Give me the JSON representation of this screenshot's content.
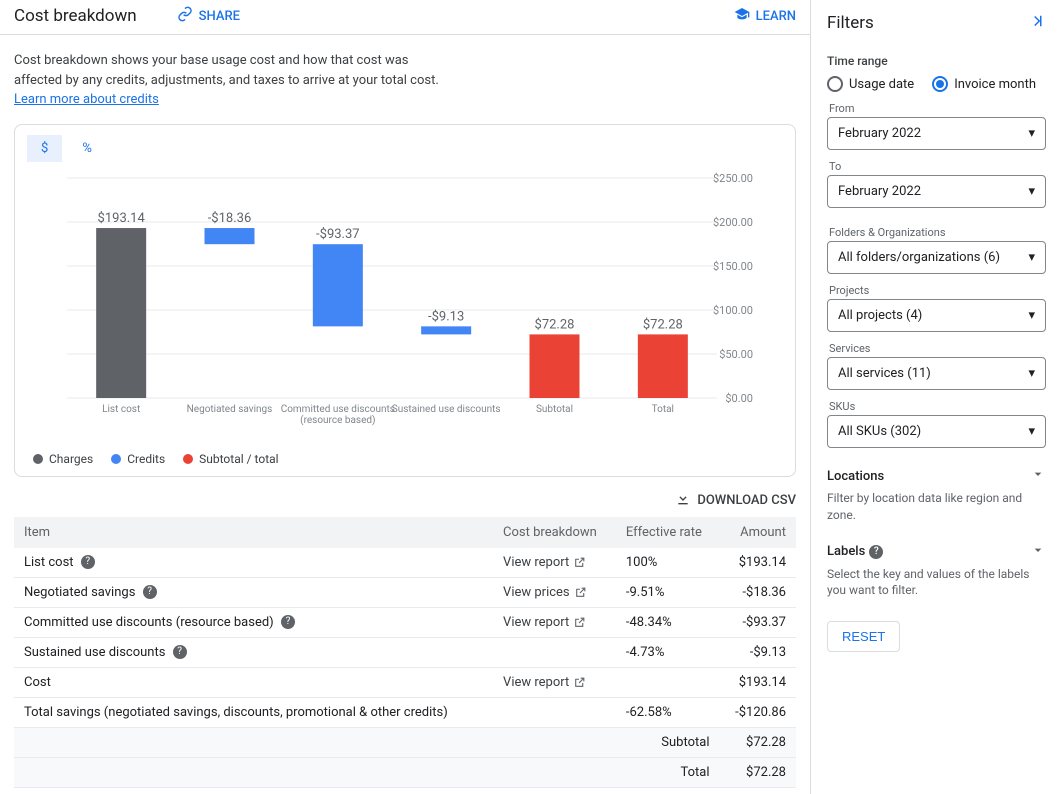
{
  "header": {
    "title": "Cost breakdown",
    "share": "SHARE",
    "learn": "LEARN"
  },
  "desc": {
    "text": "Cost breakdown shows your base usage cost and how that cost was affected by any credits, adjustments, and taxes to arrive at your total cost. ",
    "link": "Learn more about credits"
  },
  "tabs": {
    "currency": "$",
    "percent": "%"
  },
  "chart_data": {
    "type": "bar",
    "ylim": [
      0,
      250
    ],
    "ticks": [
      "$0.00",
      "$50.00",
      "$100.00",
      "$150.00",
      "$200.00",
      "$250.00"
    ],
    "categories": [
      "List cost",
      "Negotiated savings",
      "Committed use discounts (resource based)",
      "Sustained use discounts",
      "Subtotal",
      "Total"
    ],
    "bars": [
      {
        "label": "$193.14",
        "color": "#5f6368",
        "y0": 0,
        "y1": 193.14
      },
      {
        "label": "-$18.36",
        "color": "#4285f4",
        "y0": 174.78,
        "y1": 193.14
      },
      {
        "label": "-$93.37",
        "color": "#4285f4",
        "y0": 81.41,
        "y1": 174.78
      },
      {
        "label": "-$9.13",
        "color": "#4285f4",
        "y0": 72.28,
        "y1": 81.41
      },
      {
        "label": "$72.28",
        "color": "#ea4335",
        "y0": 0,
        "y1": 72.28
      },
      {
        "label": "$72.28",
        "color": "#ea4335",
        "y0": 0,
        "y1": 72.28
      }
    ]
  },
  "legend": [
    {
      "label": "Charges",
      "color": "#5f6368"
    },
    {
      "label": "Credits",
      "color": "#4285f4"
    },
    {
      "label": "Subtotal / total",
      "color": "#ea4335"
    }
  ],
  "download": "DOWNLOAD CSV",
  "table": {
    "headers": [
      "Item",
      "Cost breakdown",
      "Effective rate",
      "Amount"
    ],
    "rows": [
      {
        "item": "List cost",
        "help": true,
        "link": "View report",
        "rate": "100%",
        "amount": "$193.14"
      },
      {
        "item": "Negotiated savings",
        "help": true,
        "link": "View prices",
        "rate": "-9.51%",
        "amount": "-$18.36"
      },
      {
        "item": "Committed use discounts (resource based)",
        "help": true,
        "link": "View report",
        "rate": "-48.34%",
        "amount": "-$93.37"
      },
      {
        "item": "Sustained use discounts",
        "help": true,
        "link": "",
        "rate": "-4.73%",
        "amount": "-$9.13"
      },
      {
        "item": "Cost",
        "help": false,
        "link": "View report",
        "rate": "",
        "amount": "$193.14"
      },
      {
        "item": "Total savings (negotiated savings, discounts, promotional & other credits)",
        "help": false,
        "link": "",
        "rate": "-62.58%",
        "amount": "-$120.86"
      }
    ],
    "subtotal_label": "Subtotal",
    "subtotal": "$72.28",
    "total_label": "Total",
    "total": "$72.28"
  },
  "filters": {
    "title": "Filters",
    "time_range": "Time range",
    "usage_date": "Usage date",
    "invoice_month": "Invoice month",
    "from_label": "From",
    "from_value": "February 2022",
    "to_label": "To",
    "to_value": "February 2022",
    "folders_label": "Folders & Organizations",
    "folders_value": "All folders/organizations (6)",
    "projects_label": "Projects",
    "projects_value": "All projects (4)",
    "services_label": "Services",
    "services_value": "All services (11)",
    "skus_label": "SKUs",
    "skus_value": "All SKUs (302)",
    "locations_label": "Locations",
    "locations_desc": "Filter by location data like region and zone.",
    "labels_label": "Labels",
    "labels_desc": "Select the key and values of the labels you want to filter.",
    "reset": "RESET"
  }
}
